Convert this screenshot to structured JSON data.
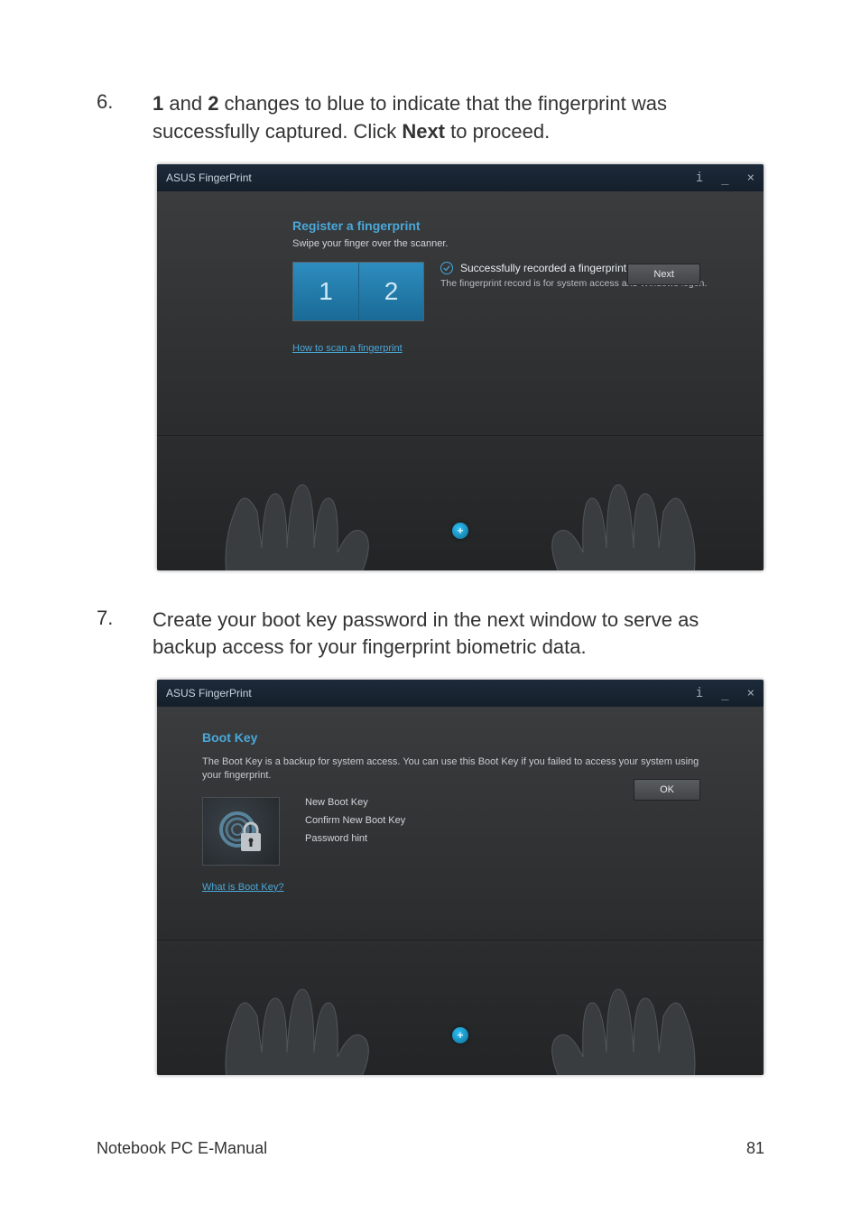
{
  "steps": {
    "six": {
      "num": "6.",
      "text_pre": "",
      "bold1": "1",
      "mid1": " and ",
      "bold2": "2",
      "mid2": " changes to blue to indicate that the fingerprint was successfully captured. Click ",
      "bold3": "Next",
      "post": " to proceed."
    },
    "seven": {
      "num": "7.",
      "text": "Create your boot key password in the next window to serve as backup access for your fingerprint biometric data."
    }
  },
  "shot1": {
    "title": "ASUS FingerPrint",
    "info_icon": "i",
    "minimize": "_",
    "close": "×",
    "heading": "Register a fingerprint",
    "sub": "Swipe your finger over the scanner.",
    "box1": "1",
    "box2": "2",
    "success_title": "Successfully recorded a fingerprint.",
    "success_sub": "The fingerprint record is for system access and Windows logon.",
    "how_link": "How to scan a fingerprint",
    "next_btn": "Next",
    "plus": "+"
  },
  "shot2": {
    "title": "ASUS FingerPrint",
    "info_icon": "i",
    "minimize": "_",
    "close": "×",
    "heading": "Boot Key",
    "desc": "The Boot Key is a backup for system access. You can use this Boot Key if you failed to access your system using your fingerprint.",
    "field1": "New Boot Key",
    "field2": "Confirm New Boot Key",
    "field3": "Password hint",
    "what_link": "What is Boot Key?",
    "ok_btn": "OK",
    "plus": "+"
  },
  "footer": {
    "left": "Notebook PC E-Manual",
    "right": "81"
  }
}
